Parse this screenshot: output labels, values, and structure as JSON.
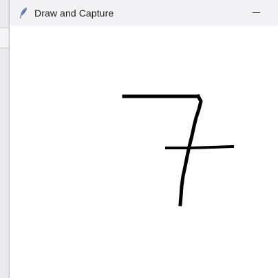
{
  "window": {
    "title": "Draw and Capture",
    "icon": "feather-icon",
    "controls": {
      "minimize_icon": "minimize-icon"
    }
  },
  "canvas": {
    "background": "#ffffff",
    "stroke_color": "#000000",
    "drawing": "handwritten-digit-7"
  }
}
